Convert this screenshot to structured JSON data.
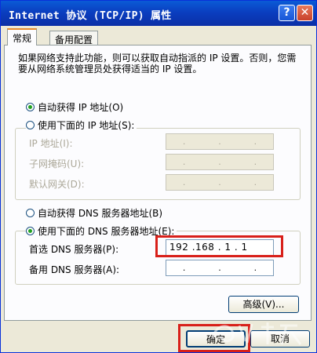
{
  "window": {
    "title": "Internet 协议 (TCP/IP) 属性",
    "help_label": "?",
    "close_label": "✕"
  },
  "tabs": [
    {
      "label": "常规",
      "active": true
    },
    {
      "label": "备用配置",
      "active": false
    }
  ],
  "description": "如果网络支持此功能，则可以获取自动指派的 IP 设置。否则，您需要从网络系统管理员处获得适当的 IP 设置。",
  "ip": {
    "auto_label": "自动获得 IP 地址(O)",
    "auto_selected": true,
    "manual_label": "使用下面的 IP 地址(S):",
    "manual_selected": false,
    "fields": [
      {
        "label": "IP 地址(I):"
      },
      {
        "label": "子网掩码(U):"
      },
      {
        "label": "默认网关(D):"
      }
    ]
  },
  "dns": {
    "auto_label": "自动获得 DNS 服务器地址(B)",
    "auto_selected": false,
    "manual_label": "使用下面的 DNS 服务器地址(E):",
    "manual_selected": true,
    "preferred_label": "首选 DNS 服务器(P):",
    "preferred_value": "192 .168 . 1 . 1",
    "alternate_label": "备用 DNS 服务器(A):",
    "alternate_value": ""
  },
  "buttons": {
    "advanced": "高级(V)...",
    "ok": "确定",
    "cancel": "取消"
  },
  "colors": {
    "titlebar": "#0a3ec0",
    "highlight": "#d8201a",
    "radio_dot": "#21a121"
  }
}
